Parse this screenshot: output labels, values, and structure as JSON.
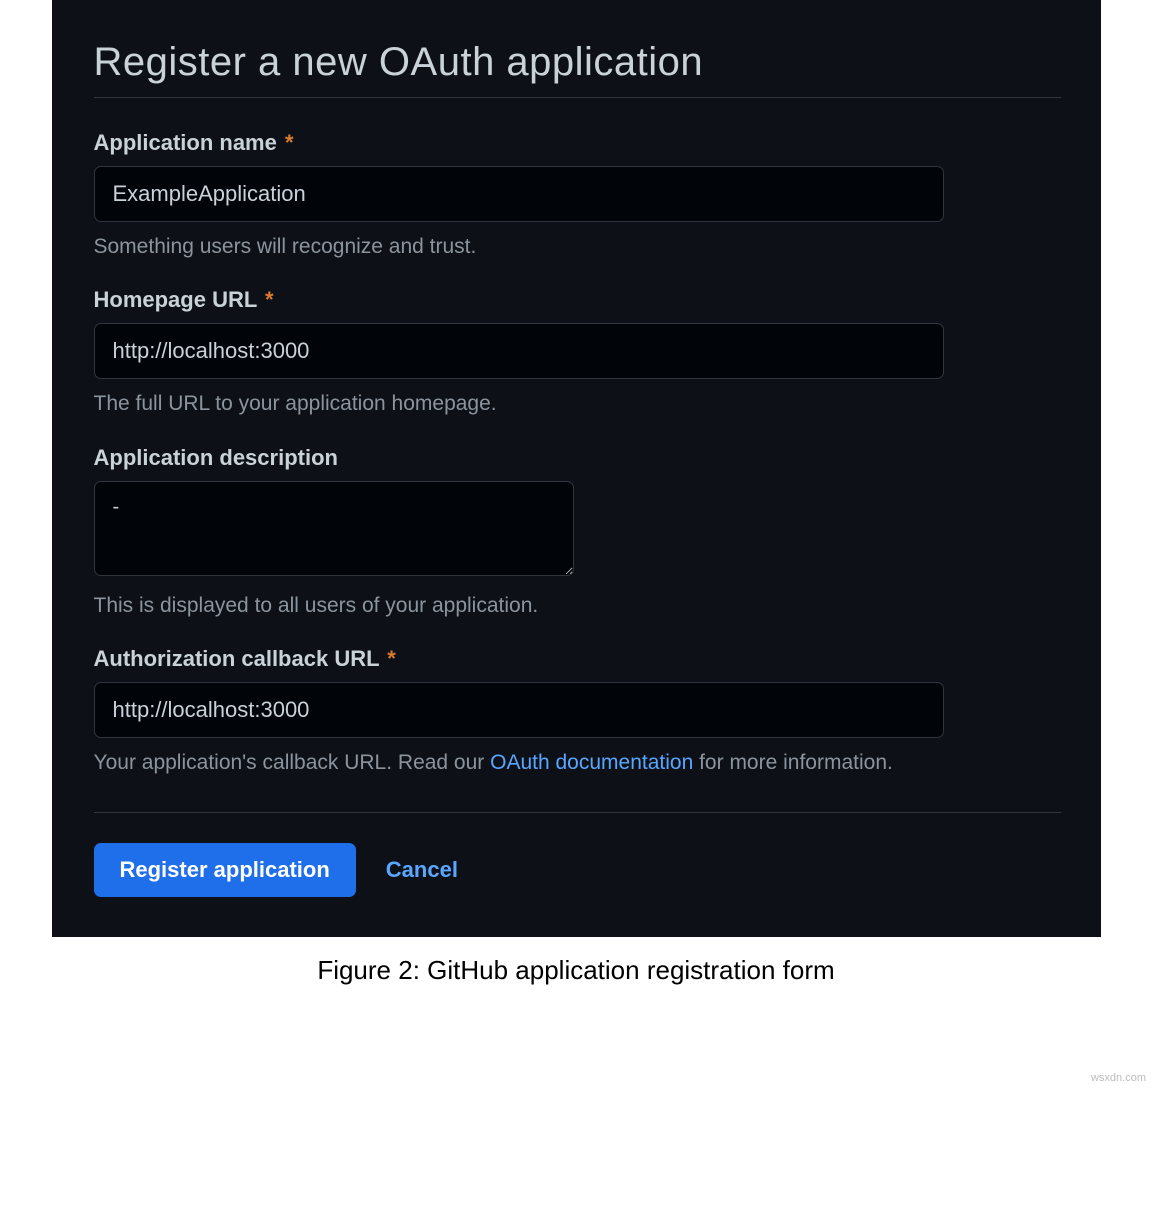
{
  "page": {
    "title": "Register a new OAuth application"
  },
  "form": {
    "app_name": {
      "label": "Application name",
      "required_marker": "*",
      "value": "ExampleApplication",
      "help": "Something users will recognize and trust."
    },
    "homepage_url": {
      "label": "Homepage URL",
      "required_marker": "*",
      "value": "http://localhost:3000",
      "help": "The full URL to your application homepage."
    },
    "description": {
      "label": "Application description",
      "value": "-",
      "help": "This is displayed to all users of your application."
    },
    "callback_url": {
      "label": "Authorization callback URL",
      "required_marker": "*",
      "value": "http://localhost:3000",
      "help_prefix": "Your application's callback URL. Read our ",
      "help_link_text": "OAuth documentation",
      "help_suffix": " for more information."
    }
  },
  "actions": {
    "submit_label": "Register application",
    "cancel_label": "Cancel"
  },
  "figure": {
    "caption": "Figure 2: GitHub application registration form"
  },
  "watermark": "wsxdn.com"
}
